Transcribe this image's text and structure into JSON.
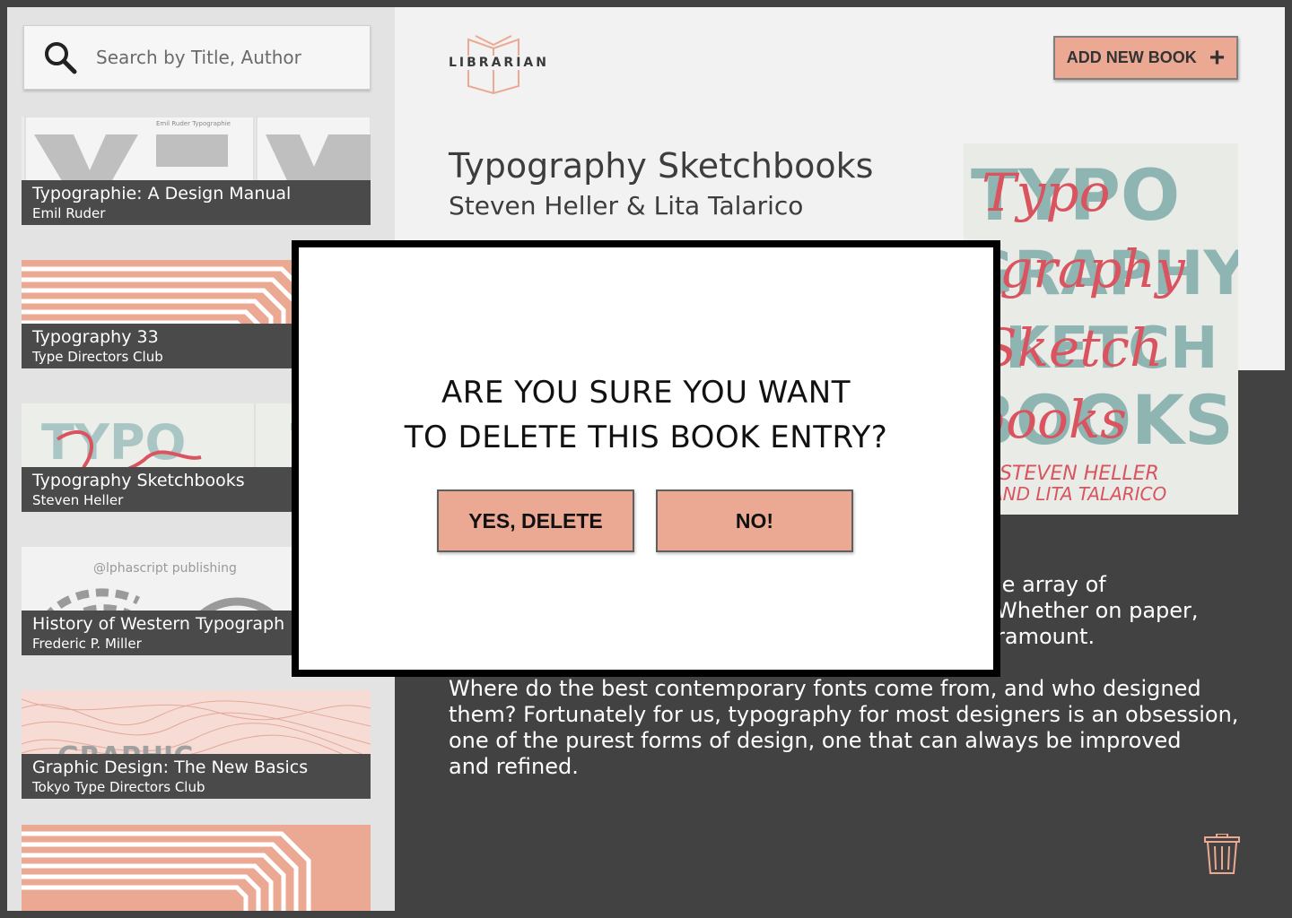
{
  "search": {
    "placeholder": "Search by Title, Author"
  },
  "books": [
    {
      "title": "Typographie: A Design Manual",
      "author": "Emil Ruder",
      "cover_text": "Emil Ruder    Typographie"
    },
    {
      "title": "Typography 33",
      "author": "Type Directors Club"
    },
    {
      "title": "Typography Sketchbooks",
      "author": "Steven Heller"
    },
    {
      "title": "History of Western Typograph",
      "author": "Frederic P. Miller",
      "cover_text": "@lphascript publishing"
    },
    {
      "title": "Graphic Design: The New Basics",
      "author": "Tokyo Type Directors Club",
      "cover_text": "GRAPHIC"
    }
  ],
  "header": {
    "logo_text": "LIBRARIAN",
    "add_button_label": "ADD NEW BOOK",
    "add_button_icon": "plus-icon"
  },
  "detail": {
    "title": "Typography Sketchbooks",
    "authors": "Steven Heller & Lita Talarico",
    "cover_lines": [
      "TYPO",
      "GRAPHY",
      "SKETCH",
      "BOOKS"
    ],
    "cover_script": [
      "Typo",
      "graphy",
      "Sketch",
      "books"
    ],
    "cover_authors": [
      "STEVEN HELLER",
      "AND LITA TALARICO"
    ],
    "description_partial": [
      "le array of",
      "Whether on paper,",
      "ramount."
    ],
    "description": [
      "Where do the best contemporary fonts come from, and who designed",
      "them? Fortunately for us, typography for most designers is an obsession,",
      "one of the purest forms of design, one that can always be improved",
      "and refined."
    ]
  },
  "modal": {
    "question_line1": "ARE YOU SURE YOU WANT",
    "question_line2": "TO DELETE THIS BOOK ENTRY?",
    "confirm_label": "YES, DELETE",
    "cancel_label": "NO!"
  },
  "colors": {
    "accent": "#eba993",
    "dark_bg": "#424242",
    "sidebar_bg": "#e3e3e3",
    "card_label_bg": "#4a4a4a",
    "cover_red": "#d9545e",
    "cover_teal": "#8fb5b3"
  }
}
